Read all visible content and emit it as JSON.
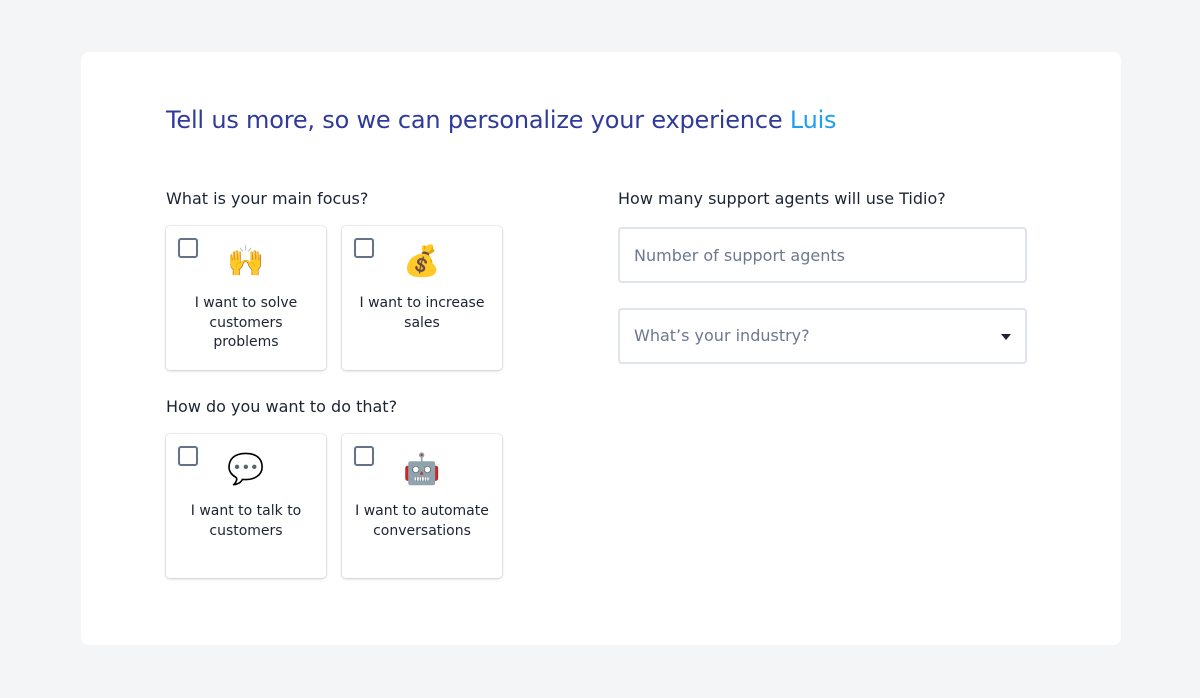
{
  "heading": {
    "text": "Tell us more, so we can personalize your experience",
    "name": "Luis"
  },
  "focus": {
    "question": "What is your main focus?",
    "options": [
      {
        "emoji": "🙌",
        "icon": "raising-hands-icon",
        "label": "I want to solve customers problems",
        "checked": false
      },
      {
        "emoji": "💰",
        "icon": "money-bag-icon",
        "label": "I want to increase sales",
        "checked": false
      }
    ]
  },
  "method": {
    "question": "How do you want to do that?",
    "options": [
      {
        "emoji": "💬",
        "icon": "speech-bubble-icon",
        "label": "I want to talk to customers",
        "checked": false
      },
      {
        "emoji": "🤖",
        "icon": "robot-icon",
        "label": "I want to automate conversations",
        "checked": false
      }
    ]
  },
  "agents": {
    "question": "How many support agents will use Tidio?",
    "placeholder": "Number of support agents",
    "value": ""
  },
  "industry": {
    "placeholder": "What’s your industry?",
    "selected": ""
  },
  "colors": {
    "page_bg": "#f4f5f7",
    "card_bg": "#ffffff",
    "heading": "#2f3a9a",
    "name_accent": "#1ea0f2",
    "text": "#1c2333",
    "placeholder": "#6b7890",
    "field_border": "#dfe3ea"
  }
}
